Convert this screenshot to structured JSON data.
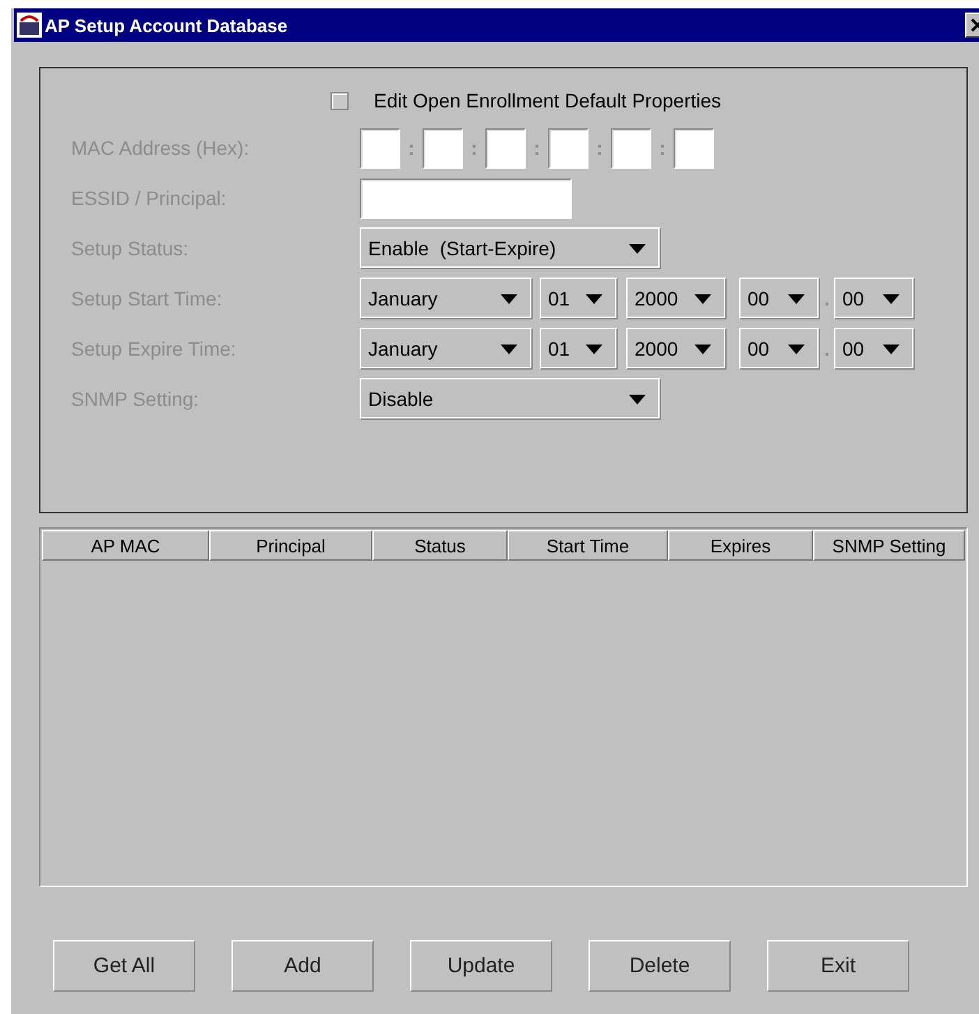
{
  "window": {
    "title": "AP Setup Account Database"
  },
  "form": {
    "disabled": true,
    "enrollment_checkbox": {
      "label": "Edit Open Enrollment Default Properties",
      "checked": false
    },
    "mac_address": {
      "label": "MAC Address (Hex):",
      "separators": [
        ":",
        ":",
        ":",
        ":",
        ":"
      ]
    },
    "essid": {
      "label": "ESSID / Principal:"
    },
    "setup_status": {
      "label": "Setup Status:",
      "value": "Enable  (Start-Expire)"
    },
    "times": [
      {
        "label": "Setup Start Time:",
        "month": "January",
        "day": "01",
        "year": "2000",
        "hour": "00",
        "separator": ".",
        "minute": "00"
      },
      {
        "label": "Setup Expire Time:",
        "month": "January",
        "day": "01",
        "year": "2000",
        "hour": "00",
        "separator": ".",
        "minute": "00"
      }
    ],
    "snmp_setting": {
      "label": "SNMP Setting:",
      "value": "Disable"
    }
  },
  "table": {
    "columns": [
      "AP MAC",
      "Principal",
      "Status",
      "Start Time",
      "Expires",
      "SNMP Setting"
    ]
  },
  "buttons": [
    "Get All",
    "Add",
    "Update",
    "Delete",
    "Exit"
  ]
}
